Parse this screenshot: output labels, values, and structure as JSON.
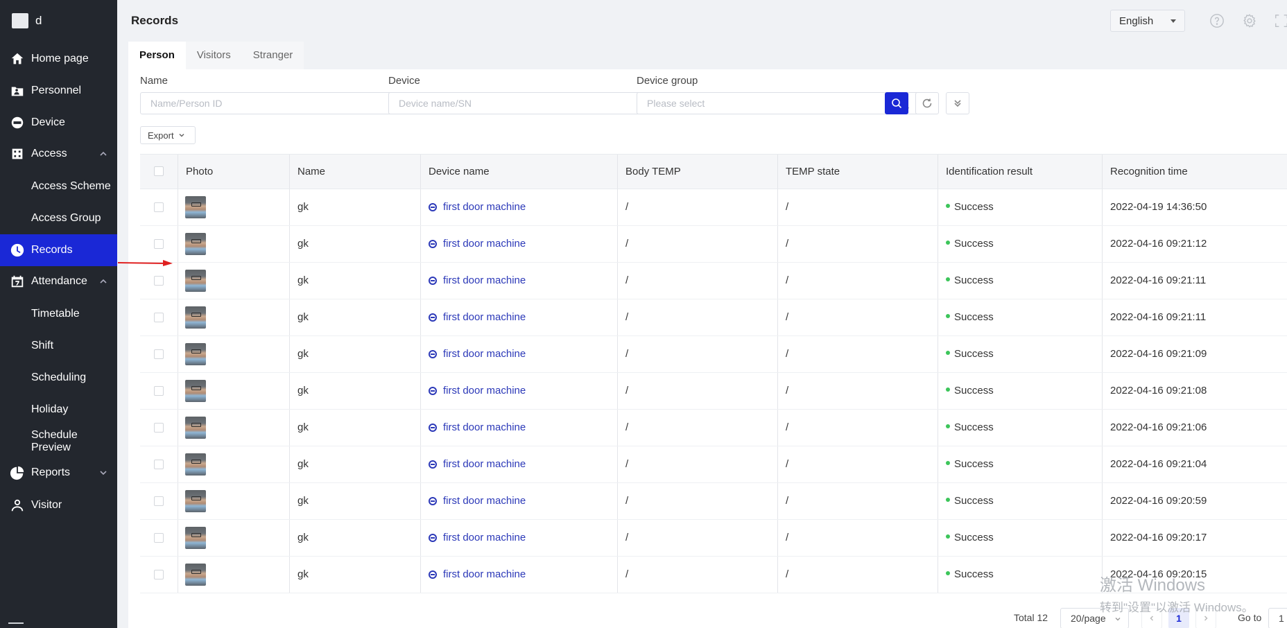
{
  "brand": {
    "label": "d"
  },
  "sidebar": {
    "items": [
      {
        "label": "Home page",
        "icon": "home-icon"
      },
      {
        "label": "Personnel",
        "icon": "personnel-icon"
      },
      {
        "label": "Device",
        "icon": "device-icon"
      },
      {
        "label": "Access",
        "icon": "access-icon",
        "expanded": true
      },
      {
        "label": "Access Scheme"
      },
      {
        "label": "Access Group"
      },
      {
        "label": "Records",
        "icon": "clock-icon",
        "active": true
      },
      {
        "label": "Attendance",
        "icon": "calendar-icon",
        "expanded": true
      },
      {
        "label": "Timetable"
      },
      {
        "label": "Shift"
      },
      {
        "label": "Scheduling"
      },
      {
        "label": "Holiday"
      },
      {
        "label": "Schedule Preview"
      },
      {
        "label": "Reports",
        "icon": "pie-chart-icon",
        "expanded": false
      },
      {
        "label": "Visitor",
        "icon": "visitor-icon"
      }
    ]
  },
  "header": {
    "title": "Records",
    "language": "English"
  },
  "tabs": [
    "Person",
    "Visitors",
    "Stranger"
  ],
  "filters": {
    "name": {
      "label": "Name",
      "placeholder": "Name/Person ID"
    },
    "device": {
      "label": "Device",
      "placeholder": "Device name/SN"
    },
    "device_group": {
      "label": "Device group",
      "placeholder": "Please select"
    }
  },
  "toolbar": {
    "export_label": "Export"
  },
  "table": {
    "columns": [
      "Photo",
      "Name",
      "Device name",
      "Body TEMP",
      "TEMP state",
      "Identification result",
      "Recognition time"
    ],
    "rows": [
      {
        "name": "gk",
        "device": "first door machine",
        "body_temp": "/",
        "temp_state": "/",
        "result": "Success",
        "time": "2022-04-19 14:36:50"
      },
      {
        "name": "gk",
        "device": "first door machine",
        "body_temp": "/",
        "temp_state": "/",
        "result": "Success",
        "time": "2022-04-16 09:21:12"
      },
      {
        "name": "gk",
        "device": "first door machine",
        "body_temp": "/",
        "temp_state": "/",
        "result": "Success",
        "time": "2022-04-16 09:21:11"
      },
      {
        "name": "gk",
        "device": "first door machine",
        "body_temp": "/",
        "temp_state": "/",
        "result": "Success",
        "time": "2022-04-16 09:21:11"
      },
      {
        "name": "gk",
        "device": "first door machine",
        "body_temp": "/",
        "temp_state": "/",
        "result": "Success",
        "time": "2022-04-16 09:21:09"
      },
      {
        "name": "gk",
        "device": "first door machine",
        "body_temp": "/",
        "temp_state": "/",
        "result": "Success",
        "time": "2022-04-16 09:21:08"
      },
      {
        "name": "gk",
        "device": "first door machine",
        "body_temp": "/",
        "temp_state": "/",
        "result": "Success",
        "time": "2022-04-16 09:21:06"
      },
      {
        "name": "gk",
        "device": "first door machine",
        "body_temp": "/",
        "temp_state": "/",
        "result": "Success",
        "time": "2022-04-16 09:21:04"
      },
      {
        "name": "gk",
        "device": "first door machine",
        "body_temp": "/",
        "temp_state": "/",
        "result": "Success",
        "time": "2022-04-16 09:20:59"
      },
      {
        "name": "gk",
        "device": "first door machine",
        "body_temp": "/",
        "temp_state": "/",
        "result": "Success",
        "time": "2022-04-16 09:20:17"
      },
      {
        "name": "gk",
        "device": "first door machine",
        "body_temp": "/",
        "temp_state": "/",
        "result": "Success",
        "time": "2022-04-16 09:20:15"
      }
    ]
  },
  "pagination": {
    "total": "Total 12",
    "page_size": "20/page",
    "current_page": "1",
    "goto_label": "Go to",
    "goto_value": "1"
  },
  "watermark": {
    "line1": "激活 Windows",
    "line2": "转到\"设置\"以激活 Windows。"
  },
  "colors": {
    "sidebar_bg": "#23272e",
    "accent": "#1a28d6",
    "link": "#2b38b8",
    "success": "#3cc55a",
    "annotation_arrow": "#e02020"
  }
}
